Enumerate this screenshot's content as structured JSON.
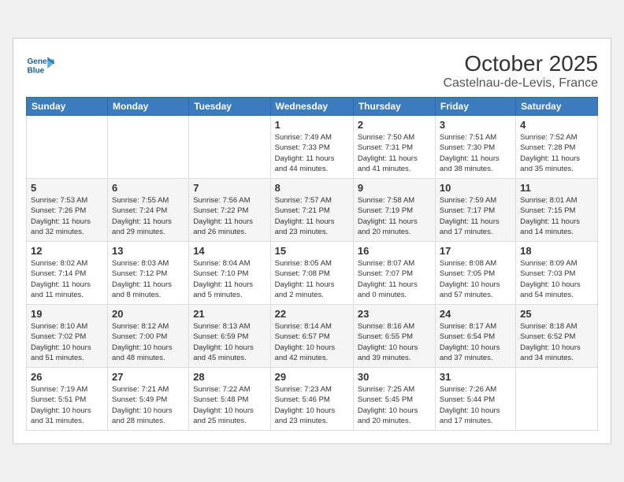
{
  "header": {
    "logo_line1": "General",
    "logo_line2": "Blue",
    "month": "October 2025",
    "location": "Castelnau-de-Levis, France"
  },
  "weekdays": [
    "Sunday",
    "Monday",
    "Tuesday",
    "Wednesday",
    "Thursday",
    "Friday",
    "Saturday"
  ],
  "weeks": [
    [
      {
        "day": "",
        "info": ""
      },
      {
        "day": "",
        "info": ""
      },
      {
        "day": "",
        "info": ""
      },
      {
        "day": "1",
        "info": "Sunrise: 7:49 AM\nSunset: 7:33 PM\nDaylight: 11 hours\nand 44 minutes."
      },
      {
        "day": "2",
        "info": "Sunrise: 7:50 AM\nSunset: 7:31 PM\nDaylight: 11 hours\nand 41 minutes."
      },
      {
        "day": "3",
        "info": "Sunrise: 7:51 AM\nSunset: 7:30 PM\nDaylight: 11 hours\nand 38 minutes."
      },
      {
        "day": "4",
        "info": "Sunrise: 7:52 AM\nSunset: 7:28 PM\nDaylight: 11 hours\nand 35 minutes."
      }
    ],
    [
      {
        "day": "5",
        "info": "Sunrise: 7:53 AM\nSunset: 7:26 PM\nDaylight: 11 hours\nand 32 minutes."
      },
      {
        "day": "6",
        "info": "Sunrise: 7:55 AM\nSunset: 7:24 PM\nDaylight: 11 hours\nand 29 minutes."
      },
      {
        "day": "7",
        "info": "Sunrise: 7:56 AM\nSunset: 7:22 PM\nDaylight: 11 hours\nand 26 minutes."
      },
      {
        "day": "8",
        "info": "Sunrise: 7:57 AM\nSunset: 7:21 PM\nDaylight: 11 hours\nand 23 minutes."
      },
      {
        "day": "9",
        "info": "Sunrise: 7:58 AM\nSunset: 7:19 PM\nDaylight: 11 hours\nand 20 minutes."
      },
      {
        "day": "10",
        "info": "Sunrise: 7:59 AM\nSunset: 7:17 PM\nDaylight: 11 hours\nand 17 minutes."
      },
      {
        "day": "11",
        "info": "Sunrise: 8:01 AM\nSunset: 7:15 PM\nDaylight: 11 hours\nand 14 minutes."
      }
    ],
    [
      {
        "day": "12",
        "info": "Sunrise: 8:02 AM\nSunset: 7:14 PM\nDaylight: 11 hours\nand 11 minutes."
      },
      {
        "day": "13",
        "info": "Sunrise: 8:03 AM\nSunset: 7:12 PM\nDaylight: 11 hours\nand 8 minutes."
      },
      {
        "day": "14",
        "info": "Sunrise: 8:04 AM\nSunset: 7:10 PM\nDaylight: 11 hours\nand 5 minutes."
      },
      {
        "day": "15",
        "info": "Sunrise: 8:05 AM\nSunset: 7:08 PM\nDaylight: 11 hours\nand 2 minutes."
      },
      {
        "day": "16",
        "info": "Sunrise: 8:07 AM\nSunset: 7:07 PM\nDaylight: 11 hours\nand 0 minutes."
      },
      {
        "day": "17",
        "info": "Sunrise: 8:08 AM\nSunset: 7:05 PM\nDaylight: 10 hours\nand 57 minutes."
      },
      {
        "day": "18",
        "info": "Sunrise: 8:09 AM\nSunset: 7:03 PM\nDaylight: 10 hours\nand 54 minutes."
      }
    ],
    [
      {
        "day": "19",
        "info": "Sunrise: 8:10 AM\nSunset: 7:02 PM\nDaylight: 10 hours\nand 51 minutes."
      },
      {
        "day": "20",
        "info": "Sunrise: 8:12 AM\nSunset: 7:00 PM\nDaylight: 10 hours\nand 48 minutes."
      },
      {
        "day": "21",
        "info": "Sunrise: 8:13 AM\nSunset: 6:59 PM\nDaylight: 10 hours\nand 45 minutes."
      },
      {
        "day": "22",
        "info": "Sunrise: 8:14 AM\nSunset: 6:57 PM\nDaylight: 10 hours\nand 42 minutes."
      },
      {
        "day": "23",
        "info": "Sunrise: 8:16 AM\nSunset: 6:55 PM\nDaylight: 10 hours\nand 39 minutes."
      },
      {
        "day": "24",
        "info": "Sunrise: 8:17 AM\nSunset: 6:54 PM\nDaylight: 10 hours\nand 37 minutes."
      },
      {
        "day": "25",
        "info": "Sunrise: 8:18 AM\nSunset: 6:52 PM\nDaylight: 10 hours\nand 34 minutes."
      }
    ],
    [
      {
        "day": "26",
        "info": "Sunrise: 7:19 AM\nSunset: 5:51 PM\nDaylight: 10 hours\nand 31 minutes."
      },
      {
        "day": "27",
        "info": "Sunrise: 7:21 AM\nSunset: 5:49 PM\nDaylight: 10 hours\nand 28 minutes."
      },
      {
        "day": "28",
        "info": "Sunrise: 7:22 AM\nSunset: 5:48 PM\nDaylight: 10 hours\nand 25 minutes."
      },
      {
        "day": "29",
        "info": "Sunrise: 7:23 AM\nSunset: 5:46 PM\nDaylight: 10 hours\nand 23 minutes."
      },
      {
        "day": "30",
        "info": "Sunrise: 7:25 AM\nSunset: 5:45 PM\nDaylight: 10 hours\nand 20 minutes."
      },
      {
        "day": "31",
        "info": "Sunrise: 7:26 AM\nSunset: 5:44 PM\nDaylight: 10 hours\nand 17 minutes."
      },
      {
        "day": "",
        "info": ""
      }
    ]
  ]
}
